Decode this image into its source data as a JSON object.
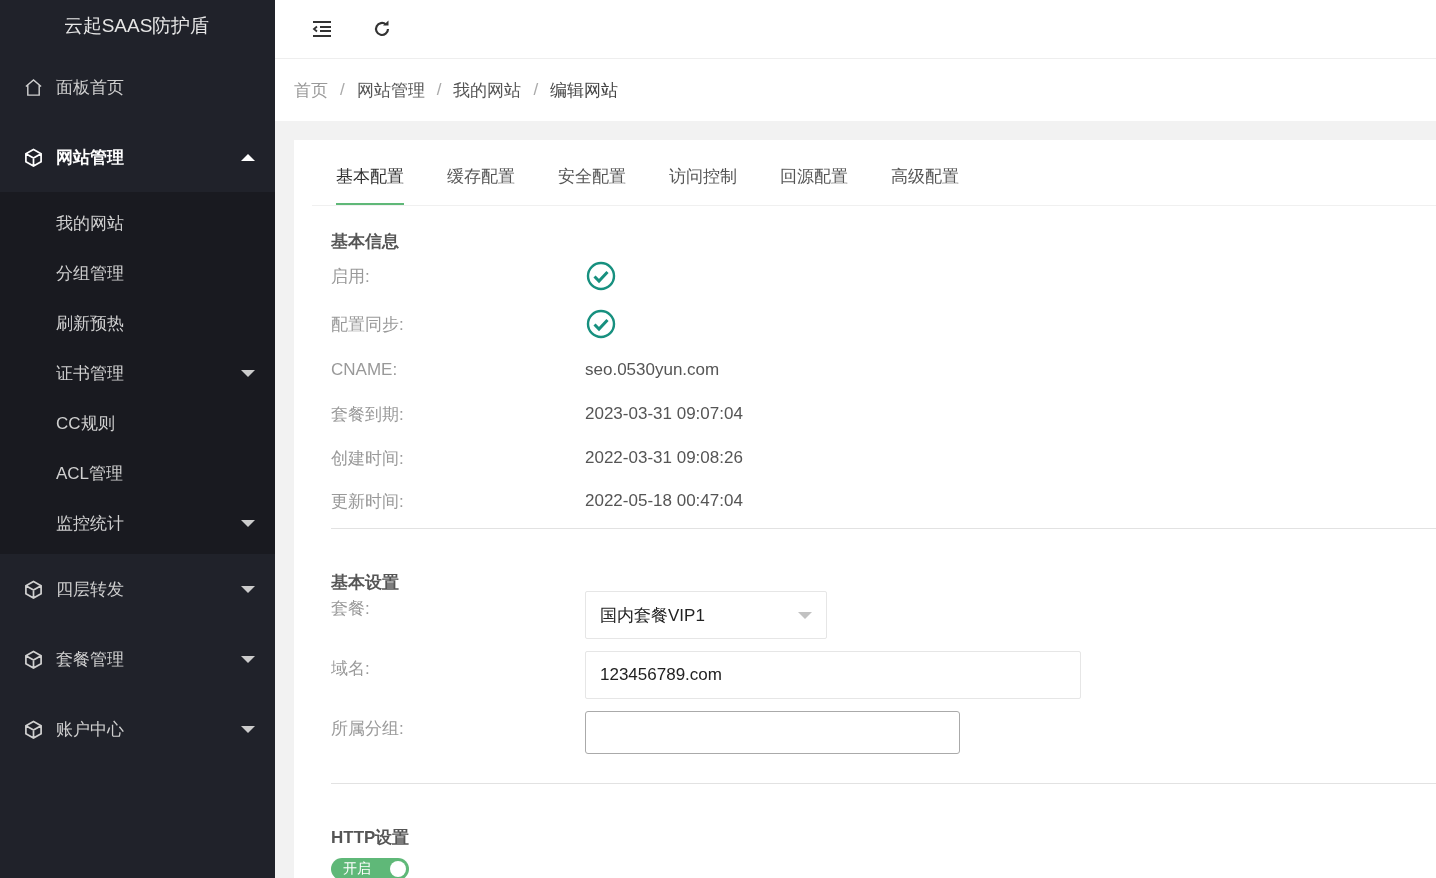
{
  "sidebar": {
    "logo": "云起SAAS防护盾",
    "items": [
      {
        "label": "面板首页",
        "kind": "link",
        "selected": false
      },
      {
        "label": "网站管理",
        "kind": "group",
        "selected": true,
        "expanded": true,
        "children": [
          {
            "label": "我的网站",
            "kind": "link"
          },
          {
            "label": "分组管理",
            "kind": "link"
          },
          {
            "label": "刷新预热",
            "kind": "link"
          },
          {
            "label": "证书管理",
            "kind": "group",
            "expanded": false
          },
          {
            "label": "CC规则",
            "kind": "link"
          },
          {
            "label": "ACL管理",
            "kind": "link"
          },
          {
            "label": "监控统计",
            "kind": "group",
            "expanded": false
          }
        ]
      },
      {
        "label": "四层转发",
        "kind": "group",
        "selected": false,
        "expanded": false
      },
      {
        "label": "套餐管理",
        "kind": "group",
        "selected": false,
        "expanded": false
      },
      {
        "label": "账户中心",
        "kind": "group",
        "selected": false,
        "expanded": false
      }
    ]
  },
  "breadcrumb": {
    "separator": "/",
    "items": [
      "首页",
      "网站管理",
      "我的网站",
      "编辑网站"
    ]
  },
  "tabs": [
    {
      "label": "基本配置",
      "selected": true
    },
    {
      "label": "缓存配置",
      "selected": false
    },
    {
      "label": "安全配置",
      "selected": false
    },
    {
      "label": "访问控制",
      "selected": false
    },
    {
      "label": "回源配置",
      "selected": false
    },
    {
      "label": "高级配置",
      "selected": false
    }
  ],
  "basic_info": {
    "title": "基本信息",
    "rows": [
      {
        "label": "启用:",
        "kind": "check",
        "checked": true
      },
      {
        "label": "配置同步:",
        "kind": "check",
        "checked": true
      },
      {
        "label": "CNAME:",
        "kind": "text",
        "value": "seo.0530yun.com"
      },
      {
        "label": "套餐到期:",
        "kind": "text",
        "value": "2023-03-31 09:07:04"
      },
      {
        "label": "创建时间:",
        "kind": "text",
        "value": "2022-03-31 09:08:26"
      },
      {
        "label": "更新时间:",
        "kind": "text",
        "value": "2022-05-18 00:47:04"
      }
    ]
  },
  "basic_settings": {
    "title": "基本设置",
    "fields": [
      {
        "label": "套餐:",
        "kind": "select",
        "value": "国内套餐VIP1",
        "focused": false
      },
      {
        "label": "域名:",
        "kind": "input",
        "value": "123456789.com",
        "focused": false
      },
      {
        "label": "所属分组:",
        "kind": "input",
        "focused": true
      }
    ]
  },
  "http_settings": {
    "title": "HTTP设置",
    "toggle": {
      "label": "开启",
      "on": true
    }
  }
}
